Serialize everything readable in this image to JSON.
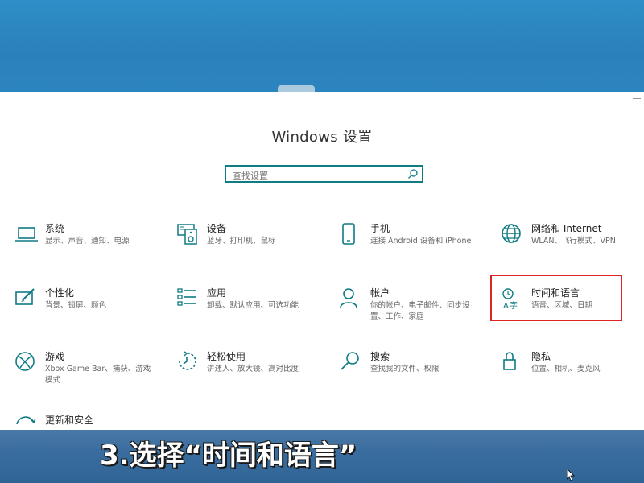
{
  "window": {
    "title": "Windows 设置"
  },
  "search": {
    "placeholder": "查找设置"
  },
  "tiles": [
    {
      "name": "系统",
      "desc": "显示、声音、通知、电源",
      "icon": "laptop-icon"
    },
    {
      "name": "设备",
      "desc": "蓝牙、打印机、鼠标",
      "icon": "devices-icon"
    },
    {
      "name": "手机",
      "desc": "连接 Android 设备和 iPhone",
      "icon": "phone-icon"
    },
    {
      "name": "网络和 Internet",
      "desc": "WLAN、飞行模式、VPN",
      "icon": "globe-icon"
    },
    {
      "name": "个性化",
      "desc": "背景、锁屏、颜色",
      "icon": "personalize-icon"
    },
    {
      "name": "应用",
      "desc": "卸载、默认应用、可选功能",
      "icon": "apps-icon"
    },
    {
      "name": "帐户",
      "desc": "你的帐户、电子邮件、同步设置、工作、家庭",
      "icon": "person-icon"
    },
    {
      "name": "时间和语言",
      "desc": "语音、区域、日期",
      "icon": "time-language-icon"
    },
    {
      "name": "游戏",
      "desc": "Xbox Game Bar、捕获、游戏模式",
      "icon": "xbox-icon"
    },
    {
      "name": "轻松使用",
      "desc": "讲述人、放大镜、高对比度",
      "icon": "ease-of-access-icon"
    },
    {
      "name": "搜索",
      "desc": "查找我的文件、权限",
      "icon": "search-icon"
    },
    {
      "name": "隐私",
      "desc": "位置、相机、麦克风",
      "icon": "lock-icon"
    },
    {
      "name": "更新和安全",
      "desc": "",
      "icon": "update-icon"
    }
  ],
  "caption": "3.选择“时间和语言”",
  "colors": {
    "accent": "#0f7b83",
    "highlight": "#e02424"
  }
}
